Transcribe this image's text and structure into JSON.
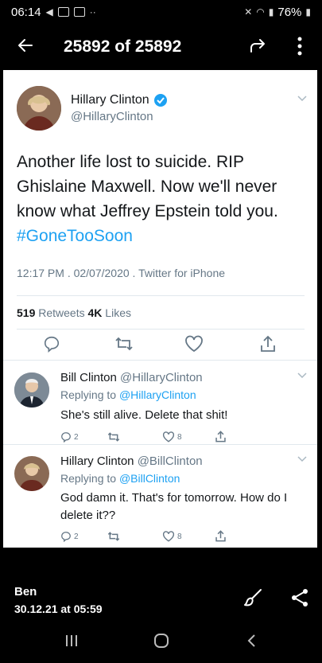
{
  "status_bar": {
    "time": "06:14",
    "battery": "76%"
  },
  "app_bar": {
    "title": "25892 of 25892"
  },
  "tweet": {
    "author_name": "Hillary Clinton",
    "author_handle": "@HillaryClinton",
    "text_line1": "Another life lost to suicide. RIP",
    "text_line2": "Ghislaine Maxwell. Now we'll never",
    "text_line3": "know what Jeffrey Epstein told you.",
    "hashtag": "#GoneTooSoon",
    "meta": "12:17 PM . 02/07/2020 . Twitter for iPhone",
    "retweets_count": "519",
    "retweets_label": "Retweets",
    "likes_count": "4K",
    "likes_label": "Likes"
  },
  "replies": [
    {
      "name": "Bill Clinton",
      "handle": "@HillaryClinton",
      "replying_label": "Replying to",
      "replying_to": "@HillaryClinton",
      "text": "She's still alive. Delete that shit!",
      "reply_count": "2",
      "like_count": "8"
    },
    {
      "name": "Hillary Clinton",
      "handle": "@BillClinton",
      "replying_label": "Replying to",
      "replying_to": "@BillClinton",
      "text_line1": "God damn it. That's for tomorrow. How do I",
      "text_line2": "delete it??",
      "reply_count": "2",
      "like_count": "8"
    }
  ],
  "footer": {
    "sender": "Ben",
    "date": "30.12.21 at 05:59"
  },
  "colors": {
    "accent": "#1da1f2",
    "secondary_text": "#657786",
    "background": "#000000"
  }
}
